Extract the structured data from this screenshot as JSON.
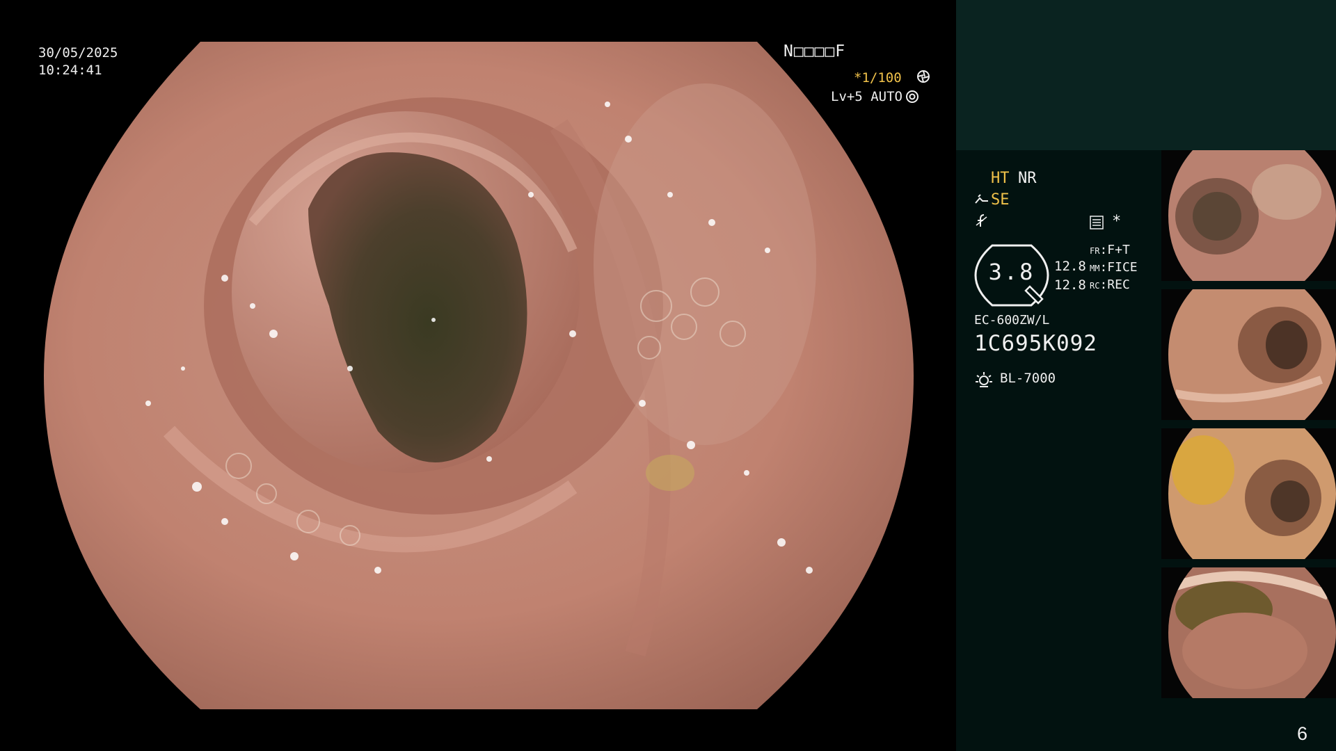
{
  "osd": {
    "date": "30/05/2025",
    "time": "10:24:41",
    "mode_code": "N□□□□F",
    "shutter": "*1/100",
    "shutter_icon": "aperture-icon",
    "level": "Lv+5 AUTO",
    "level_icon": "iris-icon"
  },
  "panel": {
    "ht": "HT",
    "nr": "NR",
    "se": "SE",
    "se_icon": "scope-tip-icon",
    "f_icon": "f-signal-icon",
    "list_icon": "list-icon",
    "star": "*",
    "hex_value": "3.8",
    "value_1": "12.8",
    "value_2": "12.8",
    "fr_label": "FR",
    "fr_value": ":F+T",
    "mm_label": "MM",
    "mm_value": ":FICE",
    "rc_label": "RC",
    "rc_value": ":REC",
    "scope_model": "EC-600ZW/L",
    "scope_serial": "1C695K092",
    "light_icon": "light-source-icon",
    "light_source": "BL-7000",
    "page_number": "6"
  },
  "colors": {
    "accent_yellow": "#f1c24a",
    "panel_top": "#0a2320",
    "panel_bottom": "#021210",
    "mucosa": "#c48a77"
  },
  "thumbnails": [
    {
      "name": "captured-image-1"
    },
    {
      "name": "captured-image-2"
    },
    {
      "name": "captured-image-3"
    },
    {
      "name": "captured-image-4"
    }
  ]
}
